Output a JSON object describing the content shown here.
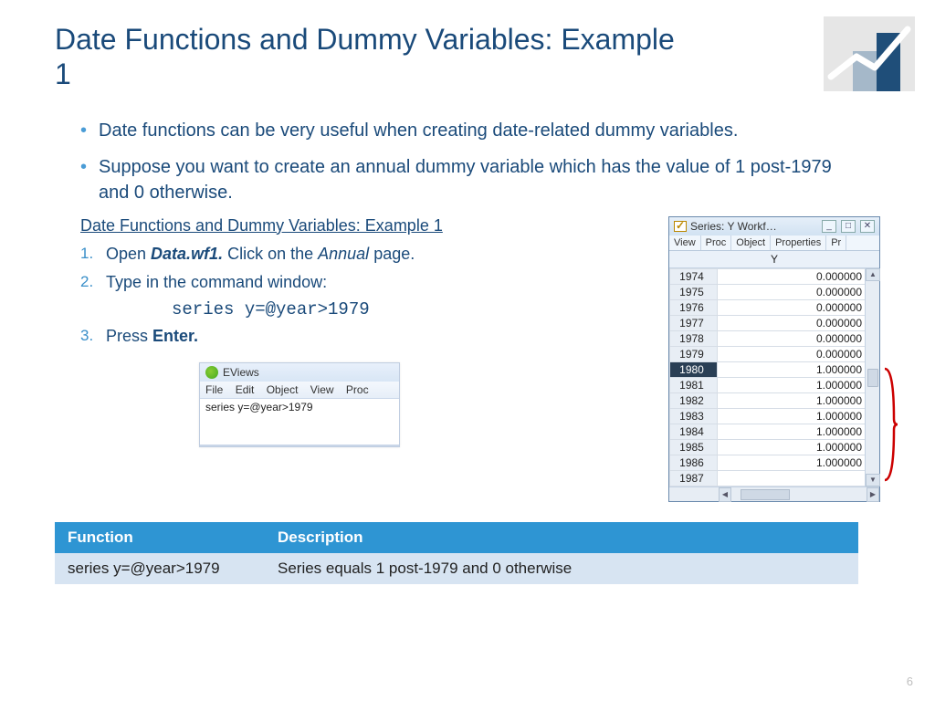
{
  "title": "Date Functions and Dummy Variables: Example 1",
  "bullets": [
    "Date functions can be very useful when creating date-related dummy variables.",
    "Suppose you want to create an annual dummy variable which has the value of 1 post-1979 and 0 otherwise."
  ],
  "sub_title": "Date Functions and Dummy Variables: Example 1",
  "steps": {
    "s1_pre": "Open ",
    "s1_bold": "Data.wf1.",
    "s1_mid": " Click on the ",
    "s1_ital": "Annual",
    "s1_post": " page.",
    "s2": "Type in the command window:",
    "cmd": "series y=@year>1979",
    "s3_pre": "Press ",
    "s3_bold": "Enter."
  },
  "eviews": {
    "app": "EViews",
    "menu": [
      "File",
      "Edit",
      "Object",
      "View",
      "Proc"
    ],
    "entered": "series y=@year>1979"
  },
  "series_window": {
    "title": "Series: Y   Workf…",
    "toolbar": [
      "View",
      "Proc",
      "Object",
      "Properties",
      "Pr"
    ],
    "col": "Y",
    "rows": [
      {
        "year": "1974",
        "val": "0.000000"
      },
      {
        "year": "1975",
        "val": "0.000000"
      },
      {
        "year": "1976",
        "val": "0.000000"
      },
      {
        "year": "1977",
        "val": "0.000000"
      },
      {
        "year": "1978",
        "val": "0.000000"
      },
      {
        "year": "1979",
        "val": "0.000000"
      },
      {
        "year": "1980",
        "val": "1.000000",
        "hl": true
      },
      {
        "year": "1981",
        "val": "1.000000"
      },
      {
        "year": "1982",
        "val": "1.000000"
      },
      {
        "year": "1983",
        "val": "1.000000"
      },
      {
        "year": "1984",
        "val": "1.000000"
      },
      {
        "year": "1985",
        "val": "1.000000"
      },
      {
        "year": "1986",
        "val": "1.000000"
      },
      {
        "year": "1987",
        "val": ""
      }
    ]
  },
  "func_table": {
    "h1": "Function",
    "h2": "Description",
    "c1": "series y=@year>1979",
    "c2": "Series equals 1 post-1979 and 0 otherwise"
  },
  "page": "6"
}
